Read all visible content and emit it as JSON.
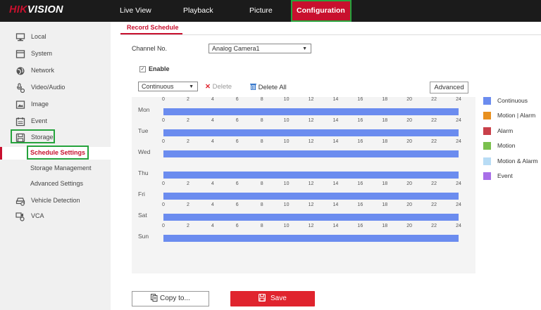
{
  "header": {
    "logo_part1": "HIK",
    "logo_part2": "VISION",
    "nav": [
      "Live View",
      "Playback",
      "Picture",
      "Configuration"
    ]
  },
  "sidebar": {
    "items": [
      {
        "label": "Local",
        "icon": "monitor-icon"
      },
      {
        "label": "System",
        "icon": "system-icon"
      },
      {
        "label": "Network",
        "icon": "globe-icon"
      },
      {
        "label": "Video/Audio",
        "icon": "video-audio-icon"
      },
      {
        "label": "Image",
        "icon": "image-icon"
      },
      {
        "label": "Event",
        "icon": "calendar-icon"
      },
      {
        "label": "Storage",
        "icon": "storage-icon"
      }
    ],
    "storage_sub": [
      "Schedule Settings",
      "Storage Management",
      "Advanced Settings"
    ],
    "items2": [
      {
        "label": "Vehicle Detection",
        "icon": "vehicle-detection-icon"
      },
      {
        "label": "VCA",
        "icon": "vca-icon"
      }
    ]
  },
  "main": {
    "tab": "Record Schedule",
    "channel_label": "Channel No.",
    "channel_value": "Analog Camera1",
    "enable_label": "Enable",
    "mode_value": "Continuous",
    "delete_label": "Delete",
    "delete_all_label": "Delete All",
    "advanced_label": "Advanced",
    "copy_label": "Copy to...",
    "save_label": "Save"
  },
  "schedule": {
    "hours": [
      "0",
      "2",
      "4",
      "6",
      "8",
      "10",
      "12",
      "14",
      "16",
      "18",
      "20",
      "22",
      "24"
    ],
    "days": [
      "Mon",
      "Tue",
      "Wed",
      "Thu",
      "Fri",
      "Sat",
      "Sun"
    ],
    "coverage": [
      [
        0,
        24
      ],
      [
        0,
        24
      ],
      [
        0,
        24
      ],
      [
        0,
        24
      ],
      [
        0,
        24
      ],
      [
        0,
        24
      ],
      [
        0,
        24
      ]
    ],
    "bar_color": "#6b8cef"
  },
  "legend": [
    {
      "label": "Continuous",
      "color": "#6b8cef"
    },
    {
      "label": "Motion | Alarm",
      "color": "#e8901f"
    },
    {
      "label": "Alarm",
      "color": "#c9404a"
    },
    {
      "label": "Motion",
      "color": "#7ac04d"
    },
    {
      "label": "Motion & Alarm",
      "color": "#b8dcf5"
    },
    {
      "label": "Event",
      "color": "#a86fe8"
    }
  ]
}
